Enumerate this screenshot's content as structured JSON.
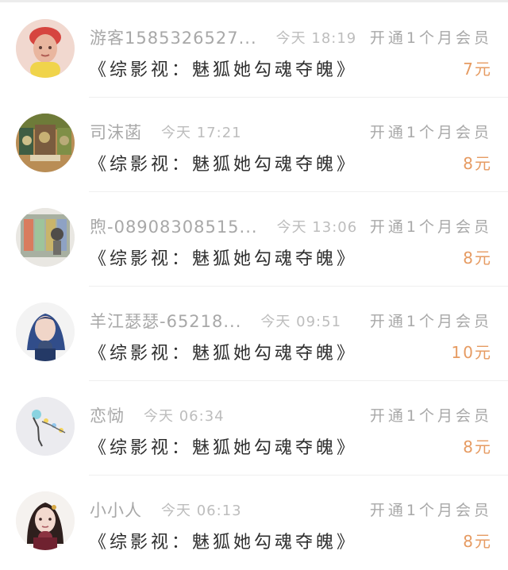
{
  "list": {
    "items": [
      {
        "name": "游客1585326527...",
        "time": "今天 18:19",
        "membership": "开通1个月会员",
        "title": "《综影视：魅狐她勾魂夺魄》",
        "price": "7元"
      },
      {
        "name": "司沫菡",
        "time": "今天 17:21",
        "membership": "开通1个月会员",
        "title": "《综影视：魅狐她勾魂夺魄》",
        "price": "8元"
      },
      {
        "name": "煦-08908308515...",
        "time": "今天 13:06",
        "membership": "开通1个月会员",
        "title": "《综影视：魅狐她勾魂夺魄》",
        "price": "8元"
      },
      {
        "name": "羊江瑟瑟-65218...",
        "time": "今天 09:51",
        "membership": "开通1个月会员",
        "title": "《综影视：魅狐她勾魂夺魄》",
        "price": "10元"
      },
      {
        "name": "恋恸",
        "time": "今天 06:34",
        "membership": "开通1个月会员",
        "title": "《综影视：魅狐她勾魂夺魄》",
        "price": "8元"
      },
      {
        "name": "小小人",
        "time": "今天 06:13",
        "membership": "开通1个月会员",
        "title": "《综影视：魅狐她勾魂夺魄》",
        "price": "8元"
      }
    ]
  },
  "colors": {
    "name": "#a8a8a8",
    "time": "#bdbdbd",
    "title": "#2f2f2f",
    "price": "#e69b62",
    "divider": "#efefef"
  },
  "icons": {
    "avatars": [
      "avatar-icon",
      "avatar-icon",
      "avatar-icon",
      "avatar-icon",
      "avatar-icon",
      "avatar-icon"
    ]
  }
}
